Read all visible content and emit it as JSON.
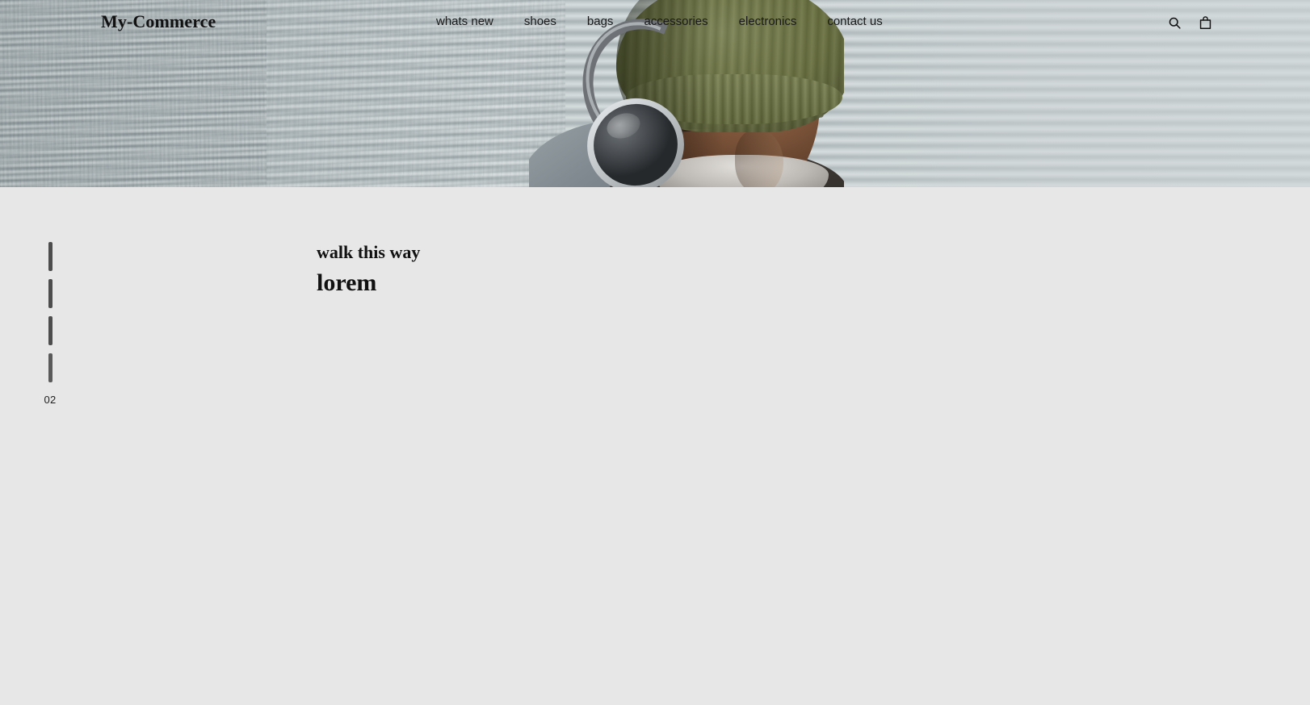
{
  "site": {
    "brand": "My-Commerce",
    "background_color": "#e7e7e7",
    "hero_background_color": "#b9c2c4",
    "text_color": "#111111"
  },
  "nav": {
    "links": [
      {
        "label": "whats new"
      },
      {
        "label": "shoes"
      },
      {
        "label": "bags"
      },
      {
        "label": "accessories"
      },
      {
        "label": "electronics"
      },
      {
        "label": "contact us"
      }
    ],
    "icons": [
      {
        "name": "search-icon",
        "label": "Search"
      },
      {
        "name": "shopping-bag-icon",
        "label": "Cart"
      }
    ]
  },
  "hero": {
    "image_alt": "Man wearing olive green knit beanie and over-ear headphones in front of a corrugated metal wall",
    "beanie_color": "#69703f",
    "headphone_color": "#4a4e52",
    "wall_color": "#c3cbcd"
  },
  "slider": {
    "ticks": 4,
    "counter": "02"
  },
  "promo": {
    "eyebrow": "walk this way",
    "headline": "lorem"
  }
}
